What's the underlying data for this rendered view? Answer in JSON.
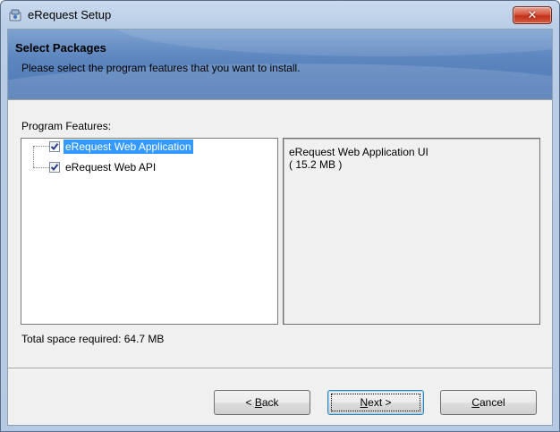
{
  "window": {
    "title": "eRequest Setup",
    "close_glyph": "✕",
    "icon": "setup-icon"
  },
  "banner": {
    "title": "Select Packages",
    "subtitle": "Please select the program features that you want to install."
  },
  "features": {
    "label": "Program Features:",
    "items": [
      {
        "label": "eRequest Web Application",
        "checked": true,
        "selected": true
      },
      {
        "label": "eRequest Web API",
        "checked": true,
        "selected": false
      }
    ]
  },
  "description": {
    "name": "eRequest Web Application UI",
    "size": "( 15.2 MB )"
  },
  "space": {
    "text": "Total space required: 64.7 MB"
  },
  "buttons": {
    "back": {
      "prefix": "< ",
      "mnemonic": "B",
      "rest": "ack"
    },
    "next": {
      "mnemonic": "N",
      "rest": "ext >"
    },
    "cancel": {
      "mnemonic": "C",
      "rest": "ancel"
    }
  },
  "colors": {
    "selection": "#3399ff",
    "banner": "#5d86bf",
    "close": "#c2311b"
  }
}
